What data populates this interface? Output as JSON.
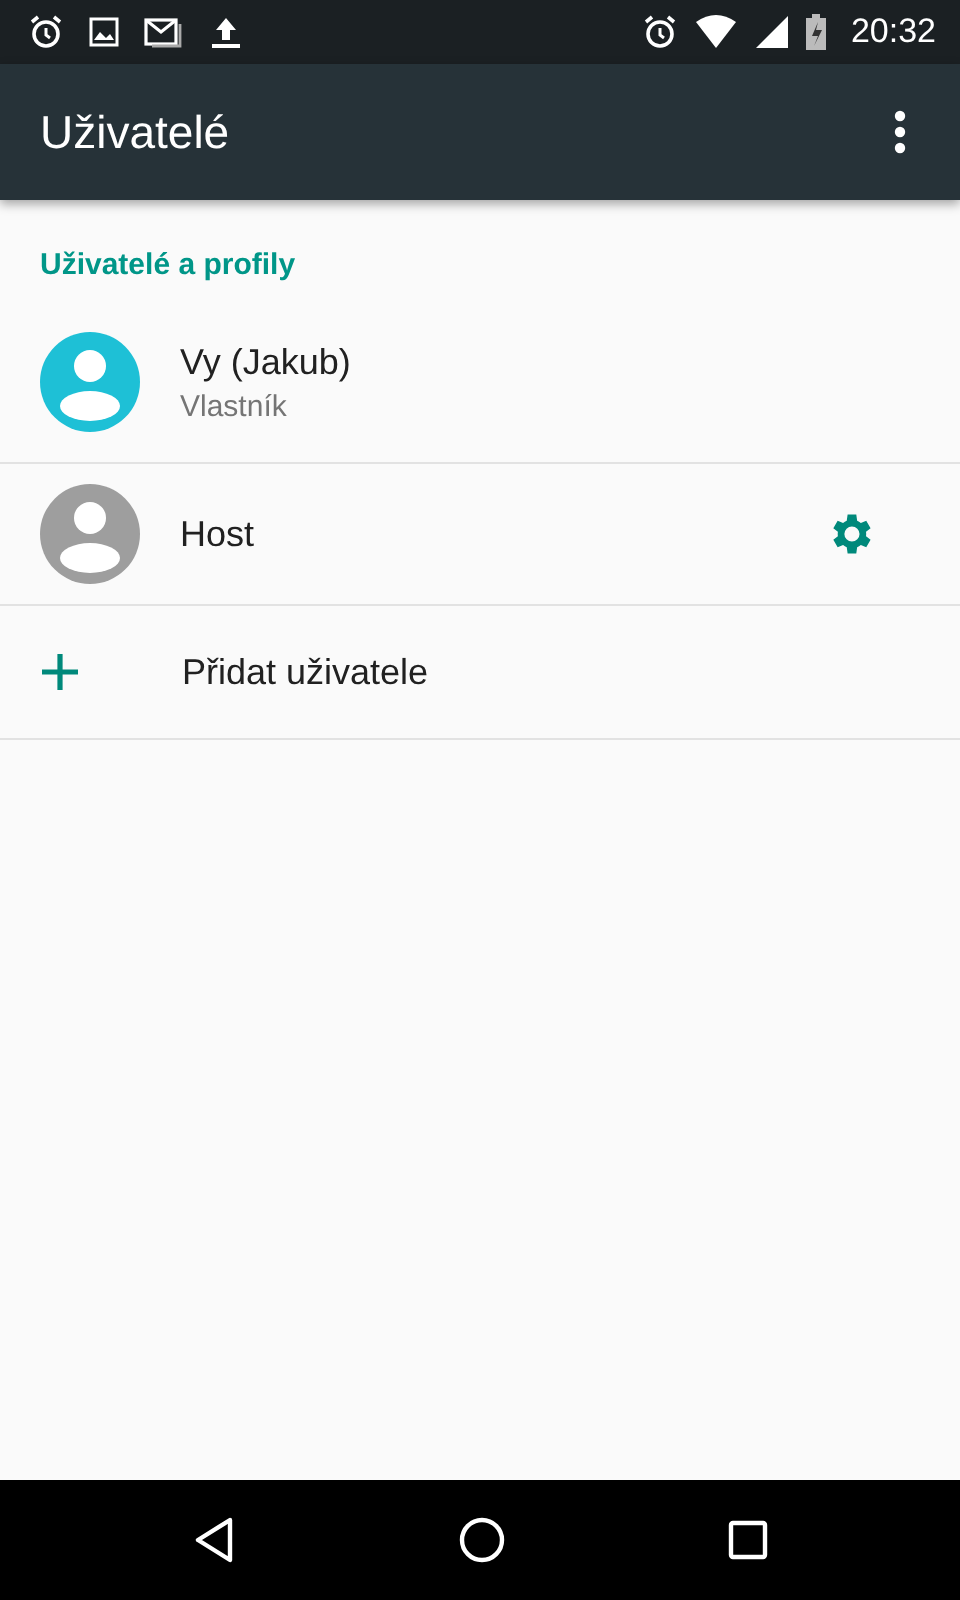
{
  "status_bar": {
    "time": "20:32"
  },
  "toolbar": {
    "title": "Uživatelé"
  },
  "section": {
    "title": "Uživatelé a profily"
  },
  "items": [
    {
      "kind": "user",
      "name": "Vy (Jakub)",
      "subtitle": "Vlastník",
      "color": "#1ec0d6",
      "settings": false
    },
    {
      "kind": "user",
      "name": "Host",
      "color": "#9e9e9e",
      "settings": true
    },
    {
      "kind": "add",
      "name": "Přidat uživatele"
    }
  ]
}
